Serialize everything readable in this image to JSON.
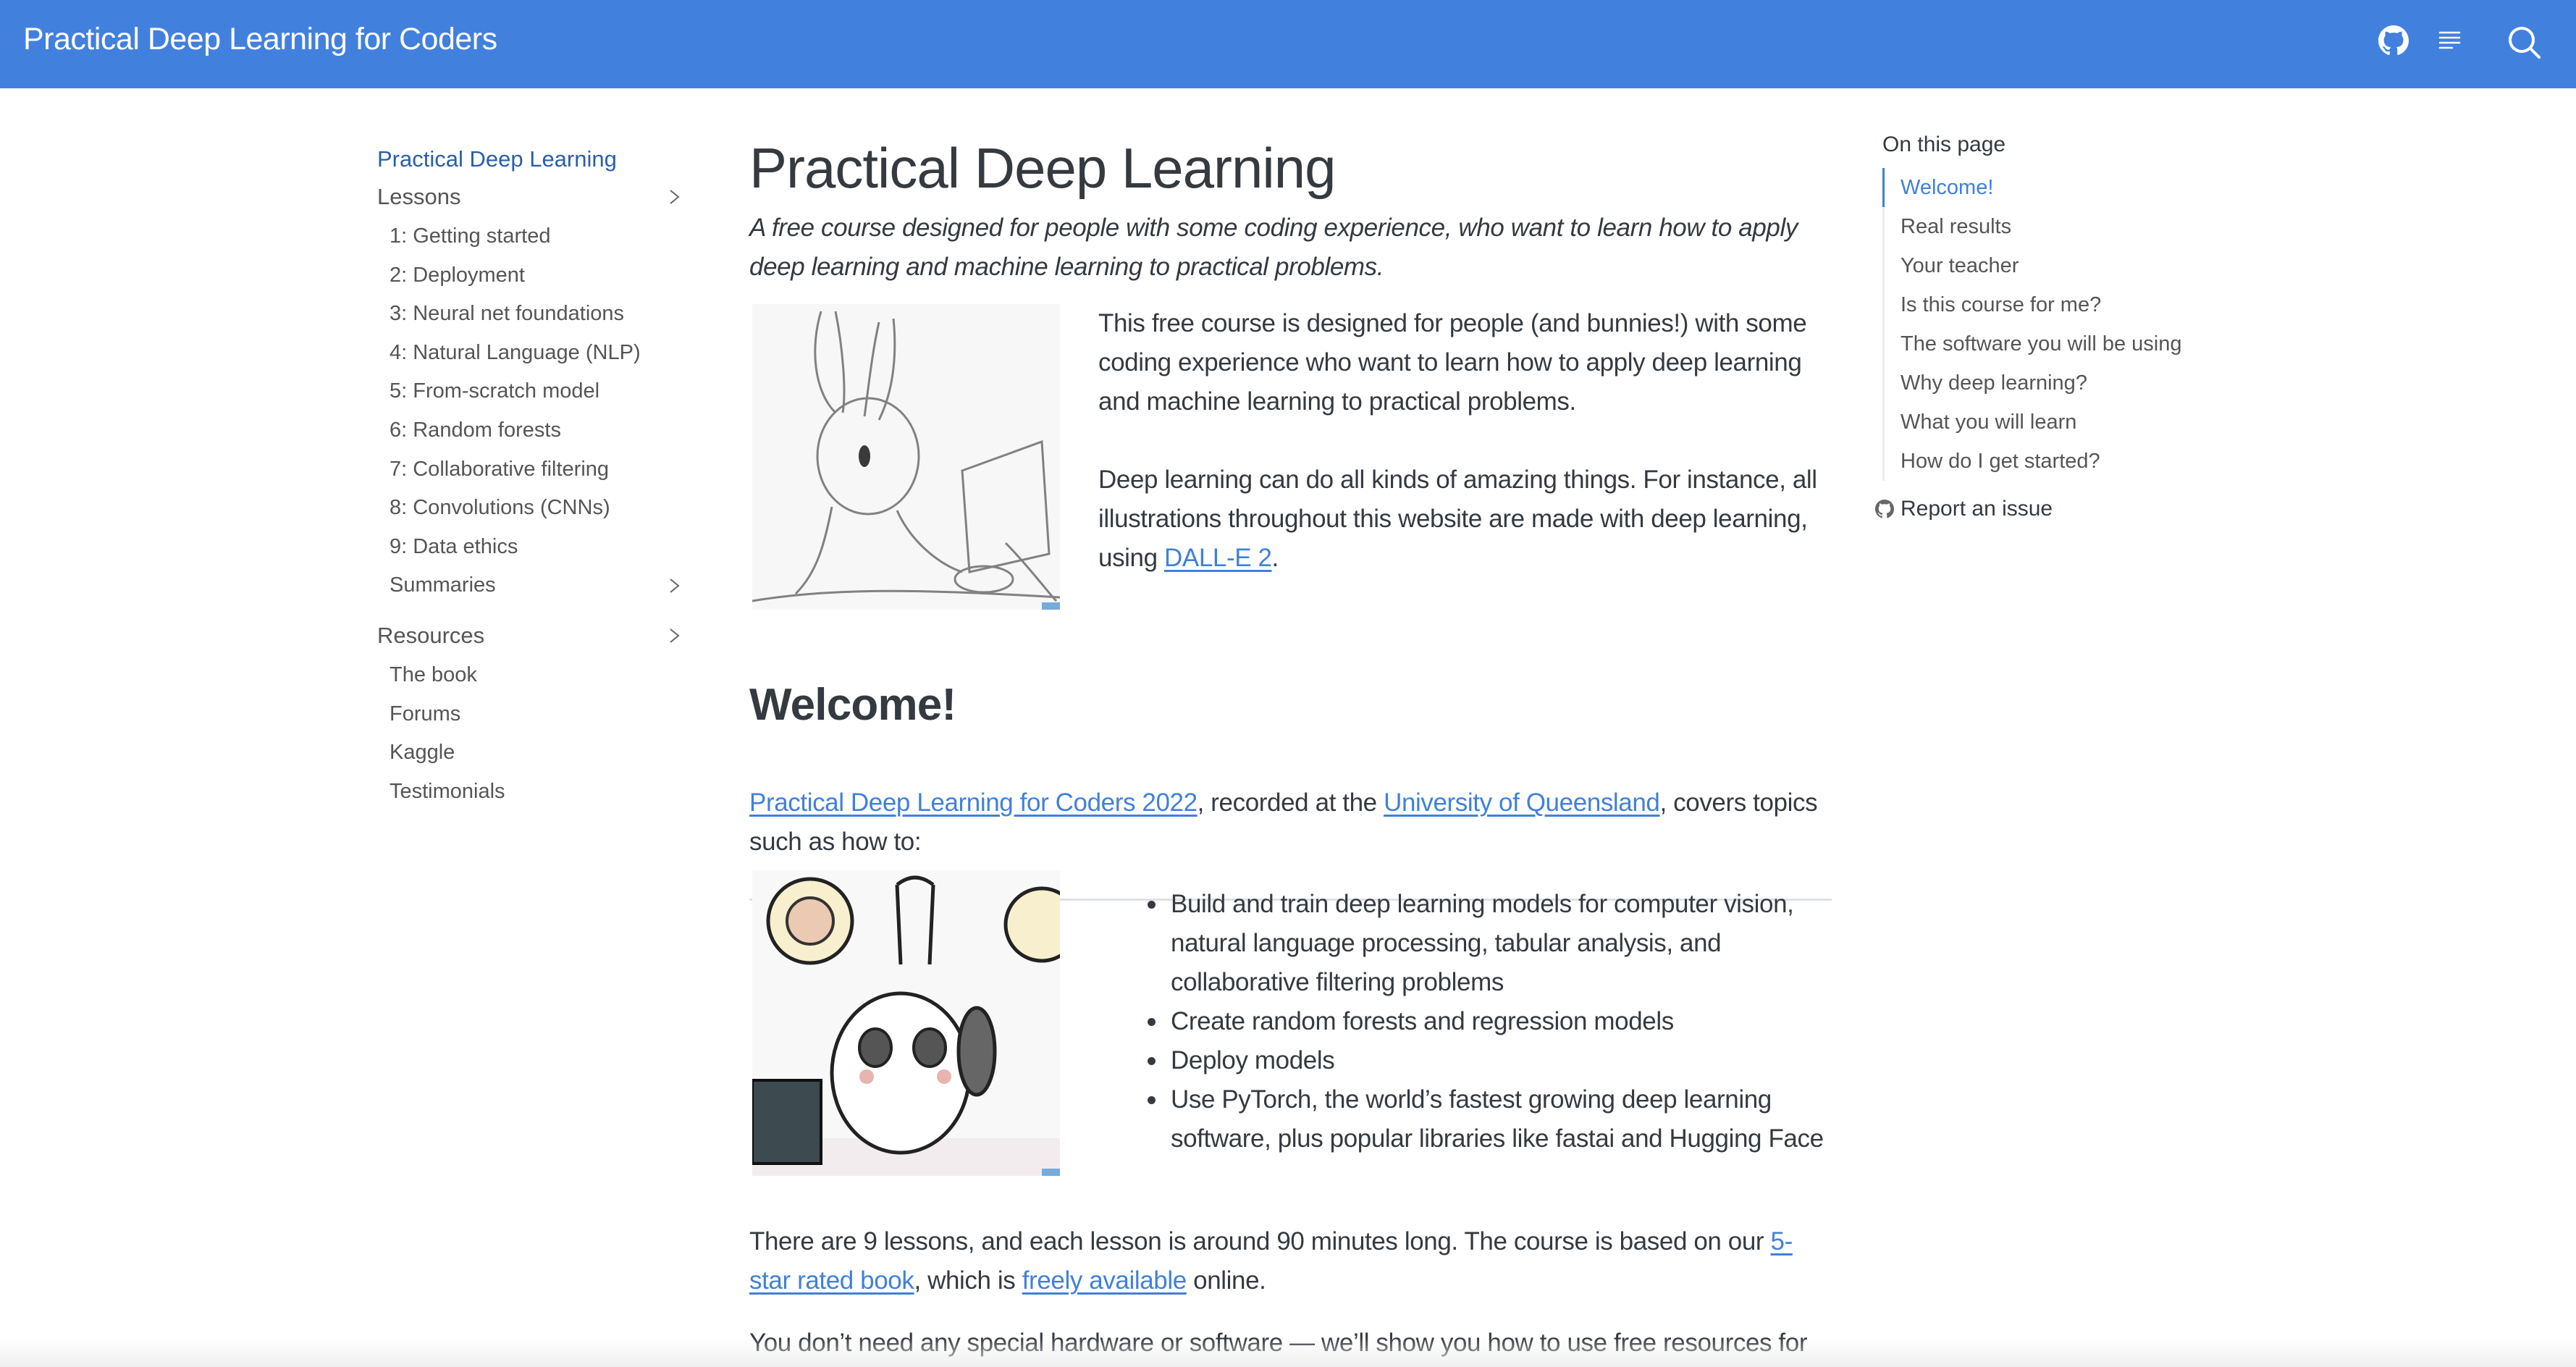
{
  "navbar": {
    "title": "Practical Deep Learning for Coders",
    "icons": [
      "github-icon",
      "toc-icon",
      "search-icon"
    ],
    "background": "#4280de"
  },
  "sidebar": {
    "home": "Practical Deep Learning",
    "lessons_label": "Lessons",
    "lessons": [
      "1: Getting started",
      "2: Deployment",
      "3: Neural net foundations",
      "4: Natural Language (NLP)",
      "5: From-scratch model",
      "6: Random forests",
      "7: Collaborative filtering",
      "8: Convolutions (CNNs)",
      "9: Data ethics",
      "Summaries"
    ],
    "resources_label": "Resources",
    "resources": [
      "The book",
      "Forums",
      "Kaggle",
      "Testimonials"
    ]
  },
  "main": {
    "title": "Practical Deep Learning",
    "subtitle": "A free course designed for people with some coding experience, who want to learn how to apply deep learning and machine learning to practical problems.",
    "intro_p1": "This free course is designed for people (and bunnies!) with some coding experience who want to learn how to apply deep learning and machine learning to practical problems.",
    "intro_p2_before": "Deep learning can do all kinds of amazing things. For instance, all illustrations throughout this website are made with deep learning, using ",
    "intro_p2_link": "DALL-E 2",
    "intro_p2_after": ".",
    "welcome_heading": "Welcome!",
    "welcome_link1": "Practical Deep Learning for Coders 2022",
    "welcome_mid": ", recorded at the ",
    "welcome_link2": "University of Queensland",
    "welcome_after": ", covers topics such as how to:",
    "bullets": [
      "Build and train deep learning models for computer vision, natural language processing, tabular analysis, and collaborative filtering problems",
      "Create random forests and regression models",
      "Deploy models",
      "Use PyTorch, the world’s fastest growing deep learning software, plus popular libraries like fastai and Hugging Face"
    ],
    "lessons_p_before": "There are 9 lessons, and each lesson is around 90 minutes long. The course is based on our ",
    "lessons_p_link1": "5-star rated book",
    "lessons_p_mid": ", which is ",
    "lessons_p_link2": "freely available",
    "lessons_p_after": " online.",
    "hardware_p": "You don’t need any special hardware or software — we’ll show you how to use free resources for",
    "image1_alt": "pencil sketch of a bunny at a computer",
    "image2_alt": "cartoon bunny with headphones thinking"
  },
  "toc": {
    "title": "On this page",
    "items": [
      "Welcome!",
      "Real results",
      "Your teacher",
      "Is this course for me?",
      "The software you will be using",
      "Why deep learning?",
      "What you will learn",
      "How do I get started?"
    ],
    "active_index": 0,
    "report_issue": "Report an issue"
  }
}
